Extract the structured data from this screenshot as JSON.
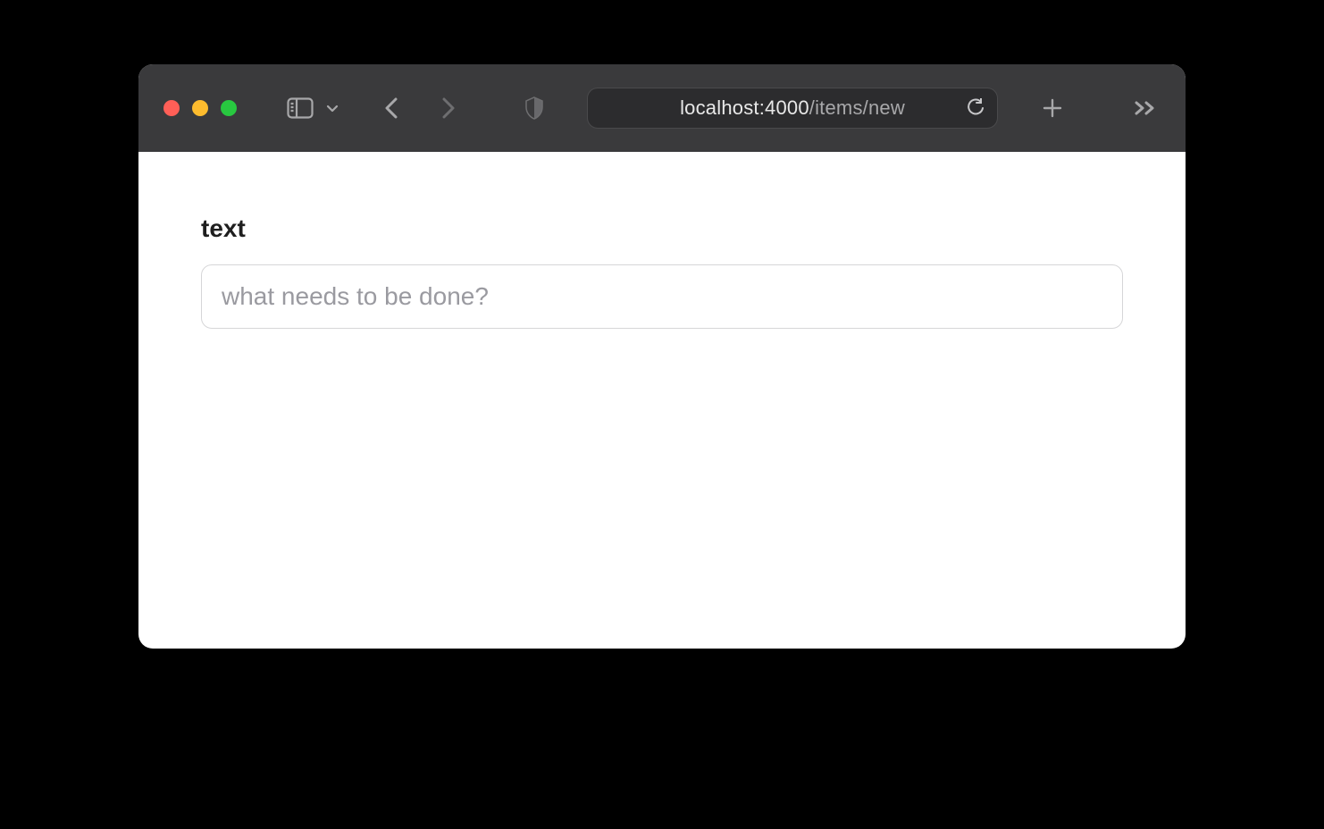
{
  "browser": {
    "url_host": "localhost:4000",
    "url_path": "/items/new"
  },
  "form": {
    "label": "text",
    "input_value": "",
    "input_placeholder": "what needs to be done?"
  }
}
